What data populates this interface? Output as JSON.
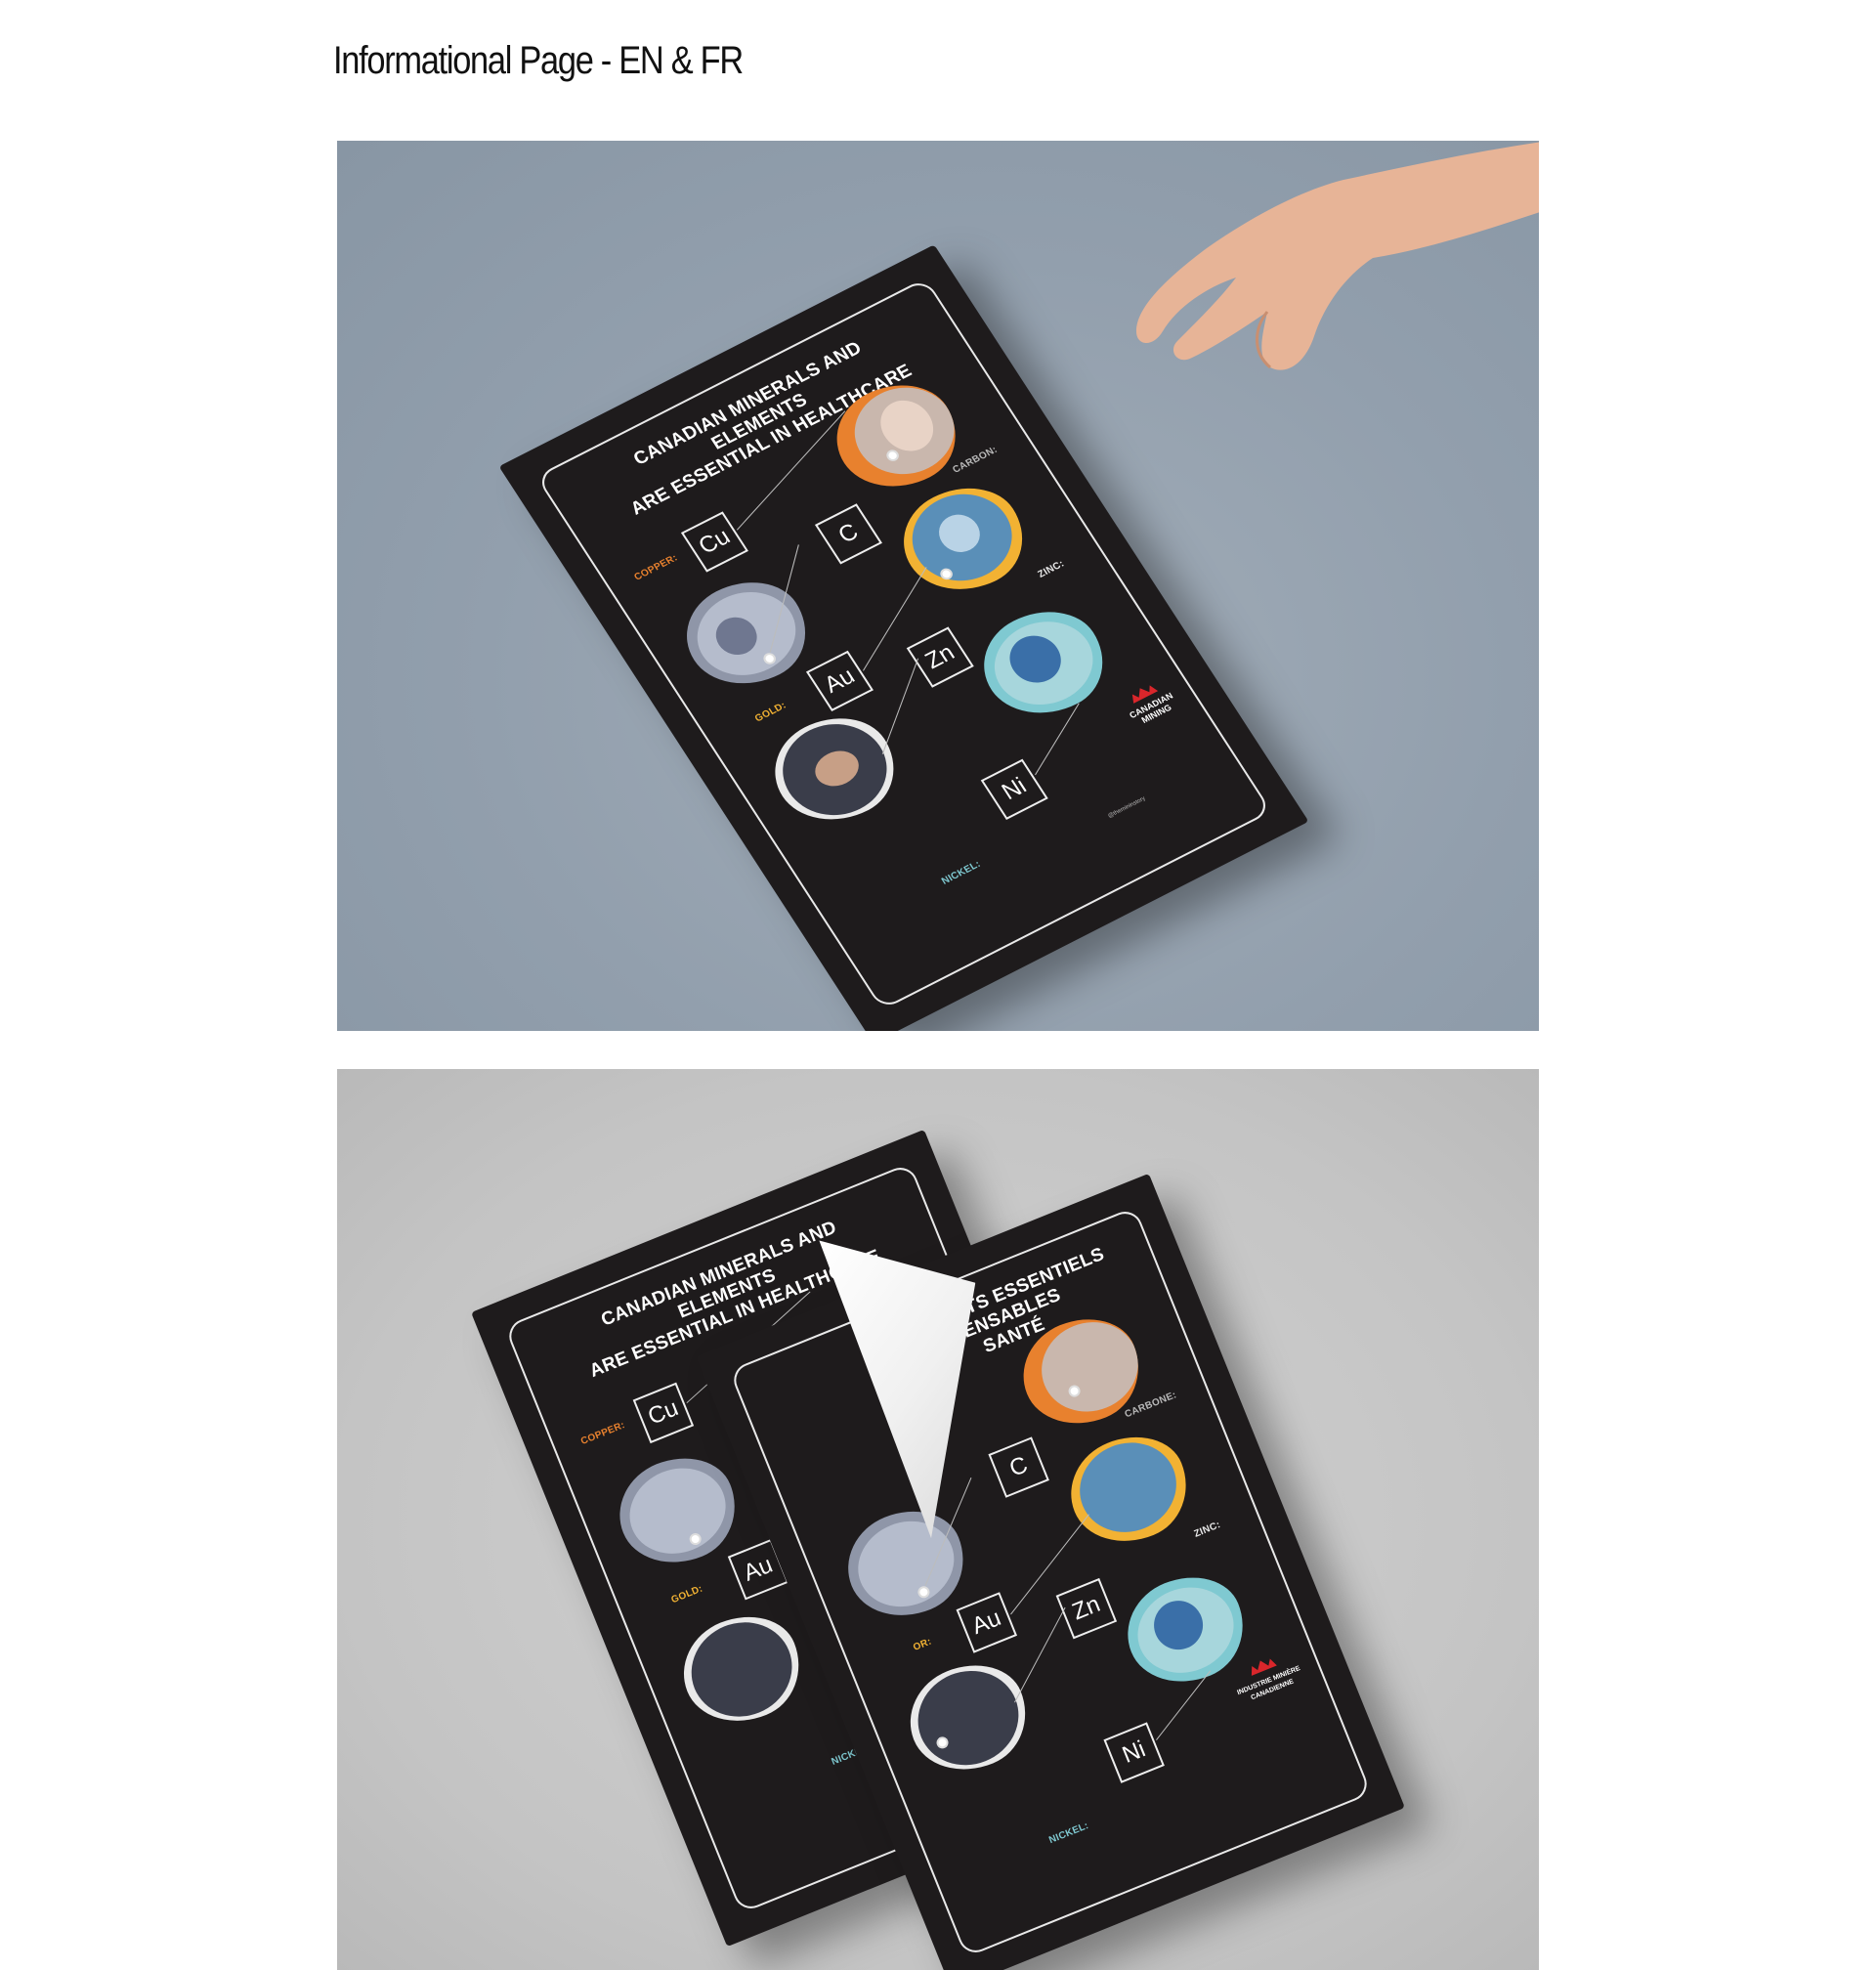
{
  "page": {
    "title": "Informational Page - EN & FR"
  },
  "flyer_en": {
    "headline_line1": "CANADIAN MINERALS AND ELEMENTS",
    "headline_line2": "ARE ESSENTIAL IN HEALTHCARE",
    "minerals": [
      {
        "symbol": "Cu",
        "label": "COPPER:",
        "color": "#e8812e"
      },
      {
        "symbol": "C",
        "label": "CARBON:",
        "color": "#b9b9b9"
      },
      {
        "symbol": "Au",
        "label": "GOLD:",
        "color": "#f2b233"
      },
      {
        "symbol": "Zn",
        "label": "ZINC:",
        "color": "#e9e9e9"
      },
      {
        "symbol": "Ni",
        "label": "NICKEL:",
        "color": "#7fc9d1"
      }
    ],
    "logo_line1": "CANADIAN",
    "logo_line2": "MINING",
    "handle": "@themininstory"
  },
  "flyer_fr": {
    "headline_line1": "ÉLÉMENTS ESSENTIELS",
    "headline_line2": "PENSABLES",
    "headline_line3": "SANTÉ",
    "minerals": [
      {
        "symbol": "C",
        "label": "CARBONE:",
        "color": "#b9b9b9"
      },
      {
        "symbol": "Au",
        "label": "OR:",
        "color": "#f2b233"
      },
      {
        "symbol": "Zn",
        "label": "ZINC:",
        "color": "#e9e9e9"
      },
      {
        "symbol": "Ni",
        "label": "NICKEL:",
        "color": "#7fc9d1"
      }
    ],
    "logo_line1": "INDUSTRIE MINIÈRE",
    "logo_line2": "CANADIENNE"
  },
  "colors": {
    "accent_red": "#d9262b",
    "flyer_bg": "#1e1b1c"
  }
}
